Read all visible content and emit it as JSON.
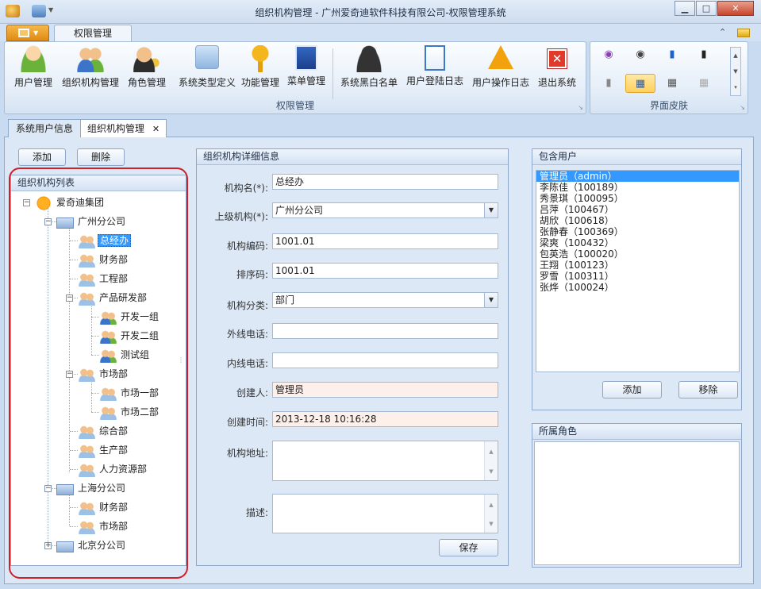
{
  "window": {
    "title": "组织机构管理 - 广州爱奇迪软件科技有限公司-权限管理系统"
  },
  "ribbon": {
    "tab": "权限管理",
    "group_label": "权限管理",
    "skin_group_label": "界面皮肤",
    "buttons": [
      {
        "label": "用户管理",
        "icon": "user-icon"
      },
      {
        "label": "组织机构管理",
        "icon": "users-group-icon"
      },
      {
        "label": "角色管理",
        "icon": "role-key-icon"
      },
      {
        "label": "系统类型定义",
        "icon": "system-type-icon"
      },
      {
        "label": "功能管理",
        "icon": "key-icon"
      },
      {
        "label": "菜单管理",
        "icon": "menu-icon"
      },
      {
        "label": "系统黑白名单",
        "icon": "blacklist-user-icon"
      },
      {
        "label": "用户登陆日志",
        "icon": "checklist-icon"
      },
      {
        "label": "用户操作日志",
        "icon": "warning-icon"
      },
      {
        "label": "退出系统",
        "icon": "exit-icon"
      }
    ]
  },
  "doc_tabs": [
    {
      "label": "系统用户信息"
    },
    {
      "label": "组织机构管理"
    }
  ],
  "toolbar": {
    "add": "添加",
    "delete": "删除"
  },
  "tree": {
    "title": "组织机构列表",
    "nodes": [
      {
        "label": "爱奇迪集团"
      },
      {
        "label": "广州分公司"
      },
      {
        "label": "总经办"
      },
      {
        "label": "财务部"
      },
      {
        "label": "工程部"
      },
      {
        "label": "产品研发部"
      },
      {
        "label": "开发一组"
      },
      {
        "label": "开发二组"
      },
      {
        "label": "测试组"
      },
      {
        "label": "市场部"
      },
      {
        "label": "市场一部"
      },
      {
        "label": "市场二部"
      },
      {
        "label": "综合部"
      },
      {
        "label": "生产部"
      },
      {
        "label": "人力资源部"
      },
      {
        "label": "上海分公司"
      },
      {
        "label": "财务部"
      },
      {
        "label": "市场部"
      },
      {
        "label": "北京分公司"
      }
    ]
  },
  "detail": {
    "title": "组织机构详细信息",
    "fields": [
      {
        "label": "机构名(*):",
        "value": "总经办"
      },
      {
        "label": "上级机构(*):",
        "value": "广州分公司"
      },
      {
        "label": "机构编码:",
        "value": "1001.01"
      },
      {
        "label": "排序码:",
        "value": "1001.01"
      },
      {
        "label": "机构分类:",
        "value": "部门"
      },
      {
        "label": "外线电话:",
        "value": ""
      },
      {
        "label": "内线电话:",
        "value": ""
      },
      {
        "label": "创建人:",
        "value": "管理员"
      },
      {
        "label": "创建时间:",
        "value": "2013-12-18 10:16:28"
      },
      {
        "label": "机构地址:",
        "value": ""
      },
      {
        "label": "描述:",
        "value": ""
      }
    ],
    "save": "保存"
  },
  "users": {
    "title": "包含用户",
    "items": [
      "管理员（admin）",
      "李陈佳（100189）",
      "秀景琪（100095）",
      "吕萍（100467）",
      "胡欣（100618）",
      "张静春（100369）",
      "梁爽（100432）",
      "包英浩（100020）",
      "王翔（100123）",
      "罗雪（100311）",
      "张烨（100024）"
    ],
    "add": "添加",
    "remove": "移除"
  },
  "roles": {
    "title": "所属角色"
  },
  "colors": {
    "accent": "#3399ff",
    "frame": "#c9dbf0",
    "annotation": "#d0202a"
  }
}
